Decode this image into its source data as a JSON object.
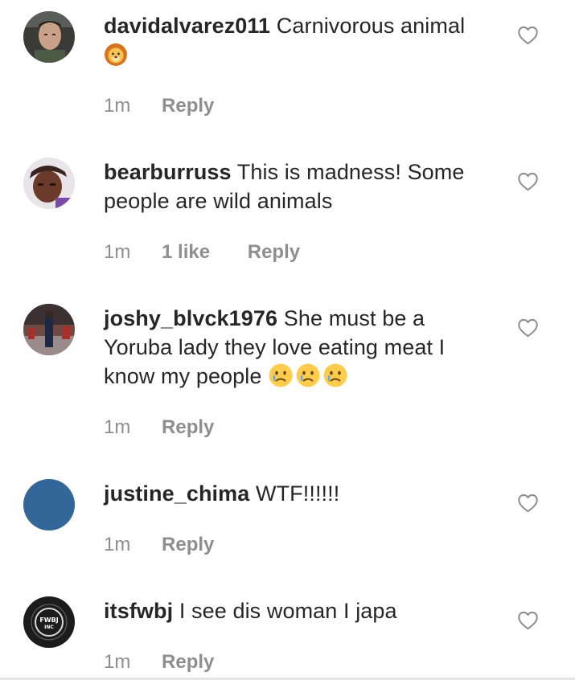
{
  "comments": [
    {
      "username": "davidalvarez011",
      "text": "Carnivorous animal",
      "emoji": "lion-face",
      "time": "1m",
      "reply_label": "Reply"
    },
    {
      "username": "bearburruss",
      "text": "This is madness! Some people are wild animals",
      "time": "1m",
      "likes": "1 like",
      "reply_label": "Reply"
    },
    {
      "username": "joshy_blvck1976",
      "text": "She must be a Yoruba lady they love eating meat I know my people",
      "emoji": "crying-face",
      "emoji_count": 3,
      "time": "1m",
      "reply_label": "Reply"
    },
    {
      "username": "justine_chima",
      "text": "WTF!!!!!!",
      "time": "1m",
      "reply_label": "Reply"
    },
    {
      "username": "itsfwbj",
      "text": "I see dis woman I japa",
      "time": "1m",
      "reply_label": "Reply",
      "avatar_text": "FWBJ INC"
    }
  ],
  "colors": {
    "text": "#262626",
    "meta": "#8e8e8e",
    "heart_outline": "#8e8e8e",
    "justine_avatar": "#336699"
  }
}
